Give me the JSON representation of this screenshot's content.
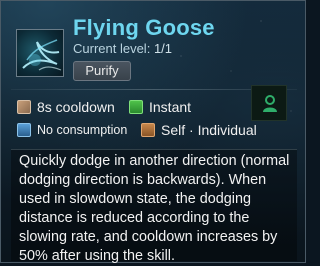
{
  "skill": {
    "name": "Flying Goose",
    "level_label": "Current level:",
    "level_value": "1/1",
    "badge": "Purify"
  },
  "stats": {
    "cooldown": "8s cooldown",
    "cast_type": "Instant",
    "consumption": "No consumption",
    "target": "Self · Individual"
  },
  "description": "Quickly dodge in another direction (normal dodging direction is backwards). When used in slowdown state, the dodging distance is reduced according to the slowing rate, and cooldown increases by 50% after using the skill.",
  "icons": {
    "skill": "flying-goose-skill-icon",
    "cooldown": "hourglass-icon",
    "cast_type": "lightning-icon",
    "consumption": "mana-icon",
    "target": "shield-icon",
    "talent": "person-icon"
  },
  "colors": {
    "skill_name": "#6ed6ef",
    "talent_icon": "#2fae6a"
  }
}
